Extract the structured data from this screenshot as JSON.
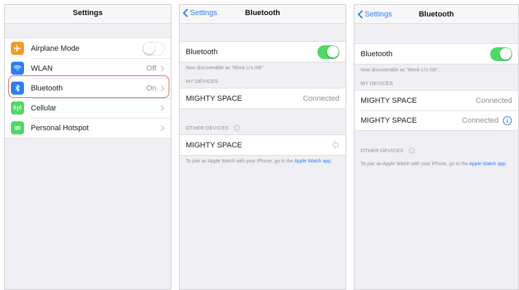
{
  "colors": {
    "accent": "#2f7cf6",
    "toggle_on": "#4cd964",
    "highlight": "#d8624f"
  },
  "screen1": {
    "title": "Settings",
    "rows": [
      {
        "label": "Airplane Mode",
        "icon": "airplane-icon",
        "control": "toggle",
        "toggle_on": false
      },
      {
        "label": "WLAN",
        "icon": "wifi-icon",
        "value": "Off"
      },
      {
        "label": "Bluetooth",
        "icon": "bluetooth-icon",
        "value": "On",
        "highlighted": true
      },
      {
        "label": "Cellular",
        "icon": "cellular-icon",
        "value": ""
      },
      {
        "label": "Personal Hotspot",
        "icon": "hotspot-icon",
        "value": ""
      }
    ]
  },
  "screen2": {
    "back": "Settings",
    "title": "Bluetooth",
    "toggle_label": "Bluetooth",
    "toggle_on": true,
    "discoverable": "Now discoverable as \"Monk Li's iSE\".",
    "my_devices_header": "MY DEVICES",
    "my_devices": [
      {
        "name": "MIGHTY SPACE",
        "status": "Connected"
      }
    ],
    "other_devices_header": "OTHER DEVICES",
    "other_devices": [
      {
        "name": "MIGHTY SPACE"
      }
    ],
    "pair_note": "To pair an Apple Watch with your iPhone, go to the",
    "pair_link": "Apple Watch app."
  },
  "screen3": {
    "back": "Settings",
    "title": "Bluetooth",
    "toggle_label": "Bluetooth",
    "toggle_on": true,
    "discoverable": "Now discoverable as \"Monk Li's iSE\".",
    "my_devices_header": "MY DEVICES",
    "my_devices": [
      {
        "name": "MIGHTY SPACE",
        "status": "Connected"
      },
      {
        "name": "MIGHTY SPACE",
        "status": "Connected",
        "info": true
      }
    ],
    "other_devices_header": "OTHER DEVICES",
    "pair_note": "To pair an Apple Watch with your iPhone, go to the",
    "pair_link": "Apple Watch app."
  }
}
